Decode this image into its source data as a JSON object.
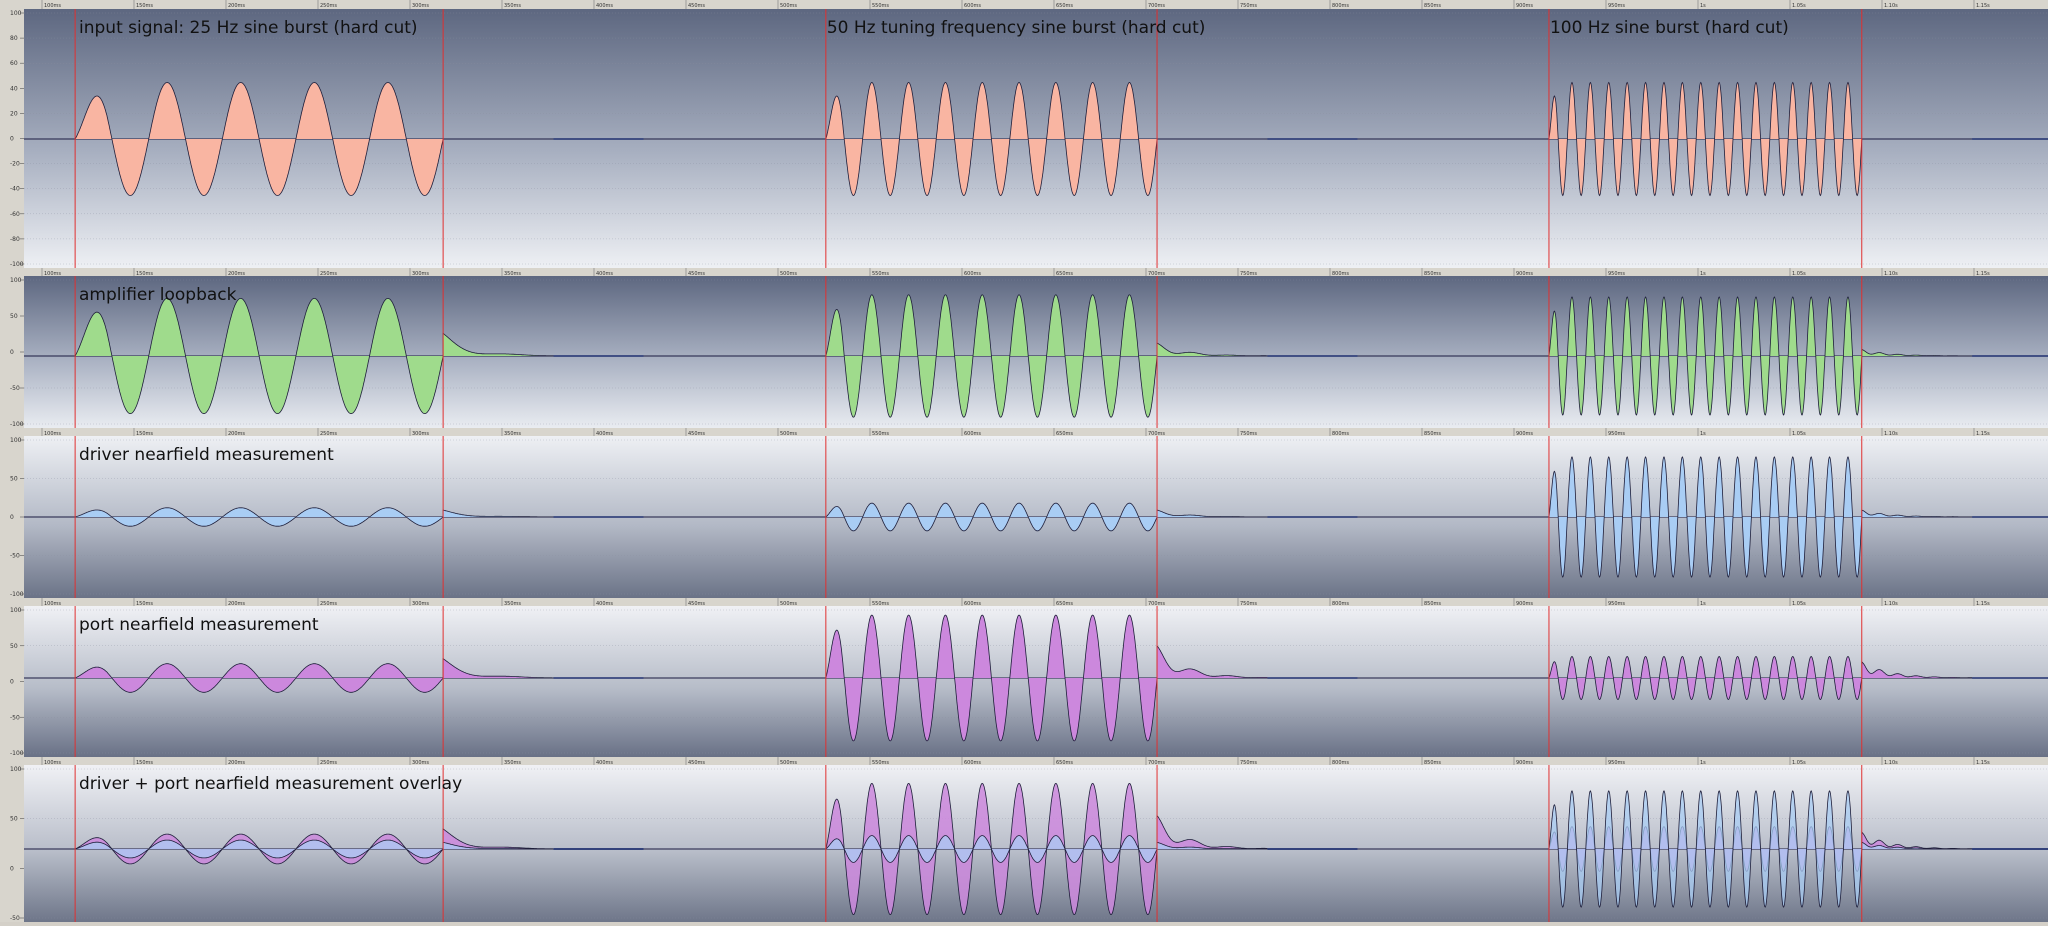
{
  "chart_data": {
    "type": "waveform",
    "time_ruler_labels": [
      "100ms",
      "150ms",
      "200ms",
      "250ms",
      "300ms",
      "350ms",
      "400ms",
      "450ms",
      "500ms",
      "550ms",
      "600ms",
      "650ms",
      "700ms",
      "750ms",
      "800ms",
      "850ms",
      "900ms",
      "950ms",
      "1s",
      "1.05s",
      "1.10s",
      "1.15s"
    ],
    "event_markers": [
      {
        "start_ms": 118,
        "end_ms": 318
      },
      {
        "start_ms": 526,
        "end_ms": 706
      },
      {
        "start_ms": 919,
        "end_ms": 1089
      }
    ],
    "colors": {
      "input": "#f9b5a2",
      "amplifier": "#9fdb8c",
      "driver": "#a9cdf4",
      "port": "#cc88dd",
      "marker": "#e03030",
      "line": "#1a1a40"
    },
    "tracks": [
      {
        "id": "input",
        "title": "input signal:  25 Hz sine burst (hard cut)",
        "y_ticks": [
          "100",
          "80",
          "60",
          "40",
          "20",
          "0",
          "-20",
          "-40",
          "-60",
          "-80",
          "-100"
        ],
        "bursts": [
          {
            "freq_hz": 25,
            "cycles": 5,
            "amplitude": 0.45,
            "release": 0
          },
          {
            "freq_hz": 50,
            "cycles": 9,
            "amplitude": 0.45,
            "release": 0
          },
          {
            "freq_hz": 100,
            "cycles": 17,
            "amplitude": 0.45,
            "release": 0
          }
        ]
      },
      {
        "id": "amplifier",
        "title": "amplifier loopback",
        "y_ticks": [
          "100",
          "50",
          "0",
          "-50",
          "-100"
        ],
        "bursts": [
          {
            "freq_hz": 25,
            "cycles": 5,
            "amplitude": 0.8,
            "release": 0.35
          },
          {
            "freq_hz": 50,
            "cycles": 9,
            "amplitude": 0.85,
            "release": 0.2
          },
          {
            "freq_hz": 100,
            "cycles": 17,
            "amplitude": 0.82,
            "release": 0.1
          }
        ]
      },
      {
        "id": "driver",
        "title": "driver nearfield measurement",
        "y_ticks": [
          "100",
          "50",
          "0",
          "-50",
          "-100"
        ],
        "bursts": [
          {
            "freq_hz": 25,
            "cycles": 5,
            "amplitude": 0.12,
            "release": 0.1
          },
          {
            "freq_hz": 50,
            "cycles": 9,
            "amplitude": 0.18,
            "release": 0.1
          },
          {
            "freq_hz": 100,
            "cycles": 17,
            "amplitude": 0.78,
            "release": 0.1
          }
        ]
      },
      {
        "id": "port",
        "title": "port nearfield measurement",
        "y_ticks": [
          "100",
          "50",
          "0",
          "-50",
          "-100"
        ],
        "bursts": [
          {
            "freq_hz": 25,
            "cycles": 5,
            "amplitude": 0.2,
            "release": 0.3
          },
          {
            "freq_hz": 50,
            "cycles": 9,
            "amplitude": 0.88,
            "release": 0.5
          },
          {
            "freq_hz": 100,
            "cycles": 17,
            "amplitude": 0.3,
            "release": 0.25
          }
        ]
      },
      {
        "id": "overlay",
        "title": "driver + port nearfield measurement overlay",
        "y_ticks": [
          "100",
          "50",
          "0",
          "-50"
        ],
        "bursts": []
      }
    ]
  }
}
